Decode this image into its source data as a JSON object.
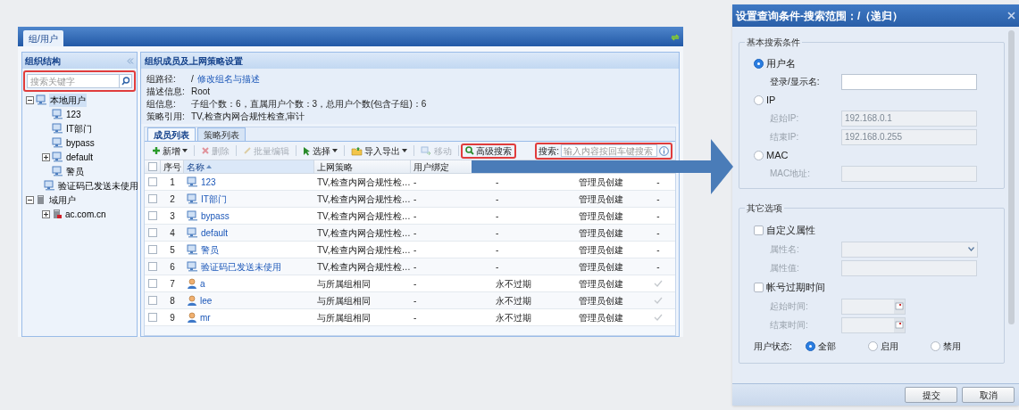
{
  "app": {
    "tab": "组/用户",
    "org_panel": {
      "title": "组织结构",
      "search_placeholder": "搜索关键字",
      "search_highlighted": true,
      "tree": [
        {
          "label": "本地用户",
          "kind": "local",
          "expanded": true,
          "selected": true,
          "children": [
            {
              "label": "123",
              "kind": "group",
              "selected": false
            },
            {
              "label": "IT部门",
              "kind": "group",
              "selected": false
            },
            {
              "label": "bypass",
              "kind": "group",
              "selected": false
            },
            {
              "label": "default",
              "kind": "group",
              "selected": false,
              "expanded": false
            },
            {
              "label": "警员",
              "kind": "group",
              "selected": false
            },
            {
              "label": "验证码已发送未使用",
              "kind": "group",
              "selected": false
            }
          ]
        },
        {
          "label": "域用户",
          "kind": "domain",
          "expanded": true,
          "selected": false,
          "children": [
            {
              "label": "ac.com.cn",
              "kind": "domain_server",
              "selected": false,
              "expanded": false
            }
          ]
        }
      ]
    },
    "members_panel": {
      "title": "组织成员及上网策略设置",
      "info": [
        {
          "label": "组路径:",
          "value": "/",
          "link": "修改组名与描述"
        },
        {
          "label": "描述信息:",
          "value": "Root"
        },
        {
          "label": "组信息:",
          "value": "子组个数：6，直属用户个数：3，总用户个数(包含子组)：6"
        },
        {
          "label": "策略引用:",
          "value": "TV,检查内网合规性检查,审计"
        }
      ],
      "tabs": [
        {
          "label": "成员列表",
          "selected": true
        },
        {
          "label": "策略列表",
          "selected": false
        }
      ],
      "toolbar": [
        {
          "label": "新增",
          "kind": "plus",
          "dropdown": true,
          "disabled": false,
          "highlighted": false
        },
        {
          "label": "删除",
          "kind": "delete",
          "dropdown": false,
          "disabled": true,
          "highlighted": false
        },
        {
          "label": "批量编辑",
          "kind": "pencil",
          "dropdown": false,
          "disabled": true,
          "highlighted": false
        },
        {
          "label": "选择",
          "kind": "cursor",
          "dropdown": true,
          "disabled": false,
          "highlighted": false
        },
        {
          "label": "导入导出",
          "kind": "folder",
          "dropdown": true,
          "disabled": false,
          "highlighted": false
        },
        {
          "label": "移动",
          "kind": "move",
          "dropdown": false,
          "disabled": true,
          "highlighted": false
        },
        {
          "label": "高级搜索",
          "kind": "search",
          "dropdown": false,
          "disabled": false,
          "highlighted": true
        }
      ],
      "search": {
        "label": "搜索:",
        "placeholder": "输入内容按回车键搜索",
        "highlighted": true
      },
      "table": {
        "all_checked": false,
        "columns": [
          {
            "label": "序号",
            "sorted": false
          },
          {
            "label": "名称",
            "sorted": true
          },
          {
            "label": "上网策略",
            "sorted": false
          },
          {
            "label": "用户绑定",
            "sorted": false
          }
        ],
        "rows": [
          {
            "checked": false,
            "index": "1",
            "name": "123",
            "kind": "group",
            "policy": "TV,检查内网合规性检…",
            "binding": "-",
            "column_5": "-",
            "column_6": "管理员创建",
            "column_7": "-"
          },
          {
            "checked": false,
            "index": "2",
            "name": "IT部门",
            "kind": "group",
            "policy": "TV,检查内网合规性检…",
            "binding": "-",
            "column_5": "-",
            "column_6": "管理员创建",
            "column_7": "-"
          },
          {
            "checked": false,
            "index": "3",
            "name": "bypass",
            "kind": "group",
            "policy": "TV,检查内网合规性检…",
            "binding": "-",
            "column_5": "-",
            "column_6": "管理员创建",
            "column_7": "-"
          },
          {
            "checked": false,
            "index": "4",
            "name": "default",
            "kind": "group",
            "policy": "TV,检查内网合规性检…",
            "binding": "-",
            "column_5": "-",
            "column_6": "管理员创建",
            "column_7": "-"
          },
          {
            "checked": false,
            "index": "5",
            "name": "警员",
            "kind": "group",
            "policy": "TV,检查内网合规性检…",
            "binding": "-",
            "column_5": "-",
            "column_6": "管理员创建",
            "column_7": "-"
          },
          {
            "checked": false,
            "index": "6",
            "name": "验证码已发送未使用",
            "kind": "group",
            "policy": "TV,检查内网合规性检…",
            "binding": "-",
            "column_5": "-",
            "column_6": "管理员创建",
            "column_7": "-"
          },
          {
            "checked": false,
            "index": "7",
            "name": "a",
            "kind": "user",
            "policy": "与所属组相同",
            "binding": "-",
            "column_5": "永不过期",
            "column_6": "管理员创建",
            "column_7_checked": true
          },
          {
            "checked": false,
            "index": "8",
            "name": "lee",
            "kind": "user",
            "policy": "与所属组相同",
            "binding": "-",
            "column_5": "永不过期",
            "column_6": "管理员创建",
            "column_7_checked": true
          },
          {
            "checked": false,
            "index": "9",
            "name": "mr",
            "kind": "user",
            "policy": "与所属组相同",
            "binding": "-",
            "column_5": "永不过期",
            "column_6": "管理员创建",
            "column_7_checked": true
          }
        ]
      }
    }
  },
  "dialog": {
    "title": "设置查询条件-搜索范围：/（递归）",
    "sections": [
      {
        "legend": "基本搜索条件",
        "items": [
          {
            "kind": "radio",
            "label": "用户名",
            "selected": true
          },
          {
            "kind": "field",
            "label": "登录/显示名:",
            "disabled": false
          },
          {
            "kind": "radio",
            "label": "IP",
            "selected": false
          },
          {
            "kind": "field",
            "label": "起始IP:",
            "value": "192.168.0.1",
            "disabled": true
          },
          {
            "kind": "field",
            "label": "结束IP:",
            "value": "192.168.0.255",
            "disabled": true
          },
          {
            "kind": "radio",
            "label": "MAC",
            "selected": false
          },
          {
            "kind": "field",
            "label": "MAC地址:",
            "disabled": true
          }
        ]
      },
      {
        "legend": "其它选项",
        "items": [
          {
            "kind": "checkbox",
            "label": "自定义属性",
            "checked": false
          },
          {
            "kind": "select",
            "label": "属性名:",
            "disabled": true
          },
          {
            "kind": "field",
            "label": "属性值:",
            "disabled": true
          },
          {
            "kind": "checkbox",
            "label": "帐号过期时间",
            "checked": false
          },
          {
            "kind": "date",
            "label": "起始时间:",
            "disabled": true
          },
          {
            "kind": "date",
            "label": "结束时间:",
            "disabled": true
          },
          {
            "kind": "radio_group",
            "label": "用户状态:",
            "options": [
              {
                "label": "全部",
                "selected": true
              },
              {
                "label": "启用",
                "selected": false
              },
              {
                "label": "禁用",
                "selected": false
              }
            ]
          }
        ]
      }
    ],
    "buttons": [
      "提交",
      "取消"
    ]
  }
}
